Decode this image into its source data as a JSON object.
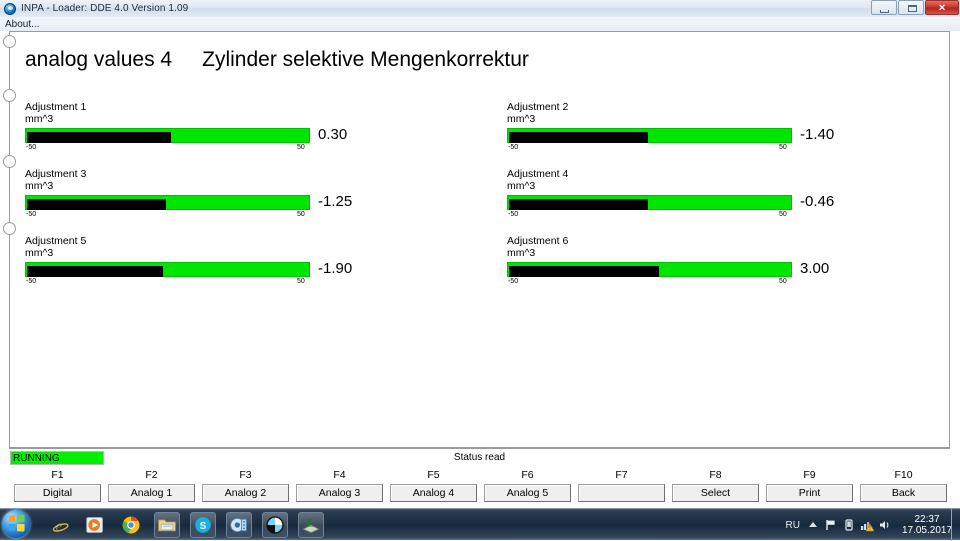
{
  "window": {
    "title": "INPA - Loader:  DDE 4.0 Version 1.09",
    "icon": "bmw-globe-icon",
    "minimize_label": "Minimize",
    "maximize_label": "Maximize",
    "close_label": "✕"
  },
  "menu": {
    "items": [
      {
        "label": "About..."
      }
    ]
  },
  "screen": {
    "heading_left": "analog values 4",
    "heading_right": "Zylinder selektive Mengenkorrektur"
  },
  "gauges": [
    {
      "label": "Adjustment 1",
      "unit": "mm^3",
      "value": "0.30",
      "min": "-50",
      "max": "50",
      "fill_pct": 51
    },
    {
      "label": "Adjustment 2",
      "unit": "mm^3",
      "value": "-1.40",
      "min": "-50",
      "max": "50",
      "fill_pct": 49
    },
    {
      "label": "Adjustment 3",
      "unit": "mm^3",
      "value": "-1.25",
      "min": "-50",
      "max": "50",
      "fill_pct": 49
    },
    {
      "label": "Adjustment 4",
      "unit": "mm^3",
      "value": "-0.46",
      "min": "-50",
      "max": "50",
      "fill_pct": 49
    },
    {
      "label": "Adjustment 5",
      "unit": "mm^3",
      "value": "-1.90",
      "min": "-50",
      "max": "50",
      "fill_pct": 48
    },
    {
      "label": "Adjustment 6",
      "unit": "mm^3",
      "value": "3.00",
      "min": "-50",
      "max": "50",
      "fill_pct": 53
    }
  ],
  "status": {
    "running_label": "RUNNING",
    "status_text": "Status read",
    "running_color": "#00ee00"
  },
  "fkeys": [
    {
      "key": "F1",
      "label": "Digital"
    },
    {
      "key": "F2",
      "label": "Analog 1"
    },
    {
      "key": "F3",
      "label": "Analog 2"
    },
    {
      "key": "F4",
      "label": "Analog 3"
    },
    {
      "key": "F5",
      "label": "Analog 4"
    },
    {
      "key": "F6",
      "label": "Analog 5"
    },
    {
      "key": "F7",
      "label": ""
    },
    {
      "key": "F8",
      "label": "Select"
    },
    {
      "key": "F9",
      "label": "Print"
    },
    {
      "key": "F10",
      "label": "Back"
    }
  ],
  "taskbar": {
    "start_label": "start-orb",
    "items": [
      {
        "icon": "internet-explorer-icon",
        "framed": false
      },
      {
        "icon": "media-player-icon",
        "framed": false
      },
      {
        "icon": "chrome-icon",
        "framed": false
      },
      {
        "icon": "file-explorer-icon",
        "framed": true
      },
      {
        "icon": "skype-icon",
        "framed": true
      },
      {
        "icon": "media-app-icon",
        "framed": true
      },
      {
        "icon": "bmw-inpa-icon",
        "framed": true
      },
      {
        "icon": "ediabas-icon",
        "framed": true
      }
    ],
    "tray": {
      "language": "RU",
      "icons": [
        "show-hidden-icons-chevron",
        "flag-action-center-icon",
        "device-icon",
        "network-warning-icon",
        "volume-icon"
      ],
      "time": "22:37",
      "date": "17.05.2017"
    }
  }
}
